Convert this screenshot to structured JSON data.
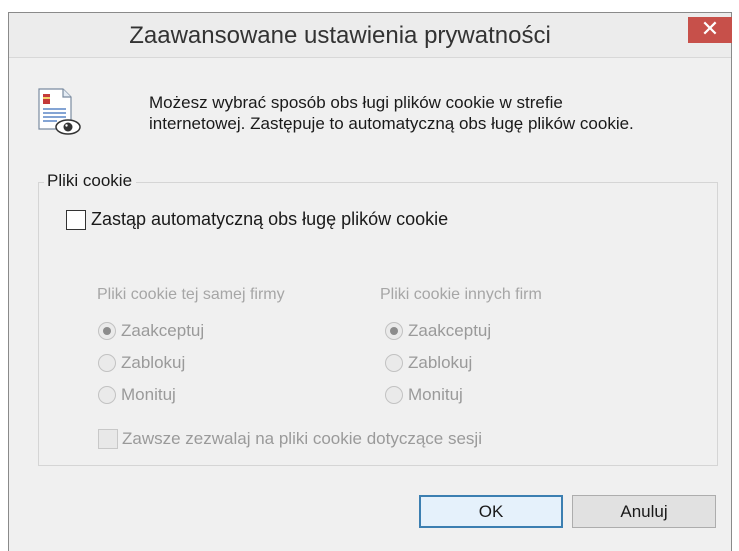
{
  "window": {
    "title": "Zaawansowane ustawienia prywatności",
    "close_glyph": "✕"
  },
  "intro": {
    "line1": "Możesz wybrać sposób obs ługi plików cookie w strefie",
    "line2": "internetowej. Zastępuje to automatyczną obs ługę plików cookie."
  },
  "group": {
    "label": "Pliki cookie",
    "override_label": "Zastąp automatyczną obs ługę plików cookie",
    "override_checked": false,
    "first_party": {
      "heading": "Pliki cookie tej samej firmy",
      "options": [
        "Zaakceptuj",
        "Zablokuj",
        "Monituj"
      ],
      "selected": "Zaakceptuj"
    },
    "third_party": {
      "heading": "Pliki cookie innych firm",
      "options": [
        "Zaakceptuj",
        "Zablokuj",
        "Monituj"
      ],
      "selected": "Zaakceptuj"
    },
    "session_label": "Zawsze zezwalaj na pliki cookie dotyczące sesji",
    "session_checked": false
  },
  "buttons": {
    "ok": "OK",
    "cancel": "Anuluj"
  },
  "colors": {
    "close_button": "#c7504a",
    "default_button_border": "#3c7fb1",
    "disabled_text": "#9a9a9a"
  },
  "icons": {
    "dialog": "document-eye-icon",
    "close": "close-icon"
  }
}
